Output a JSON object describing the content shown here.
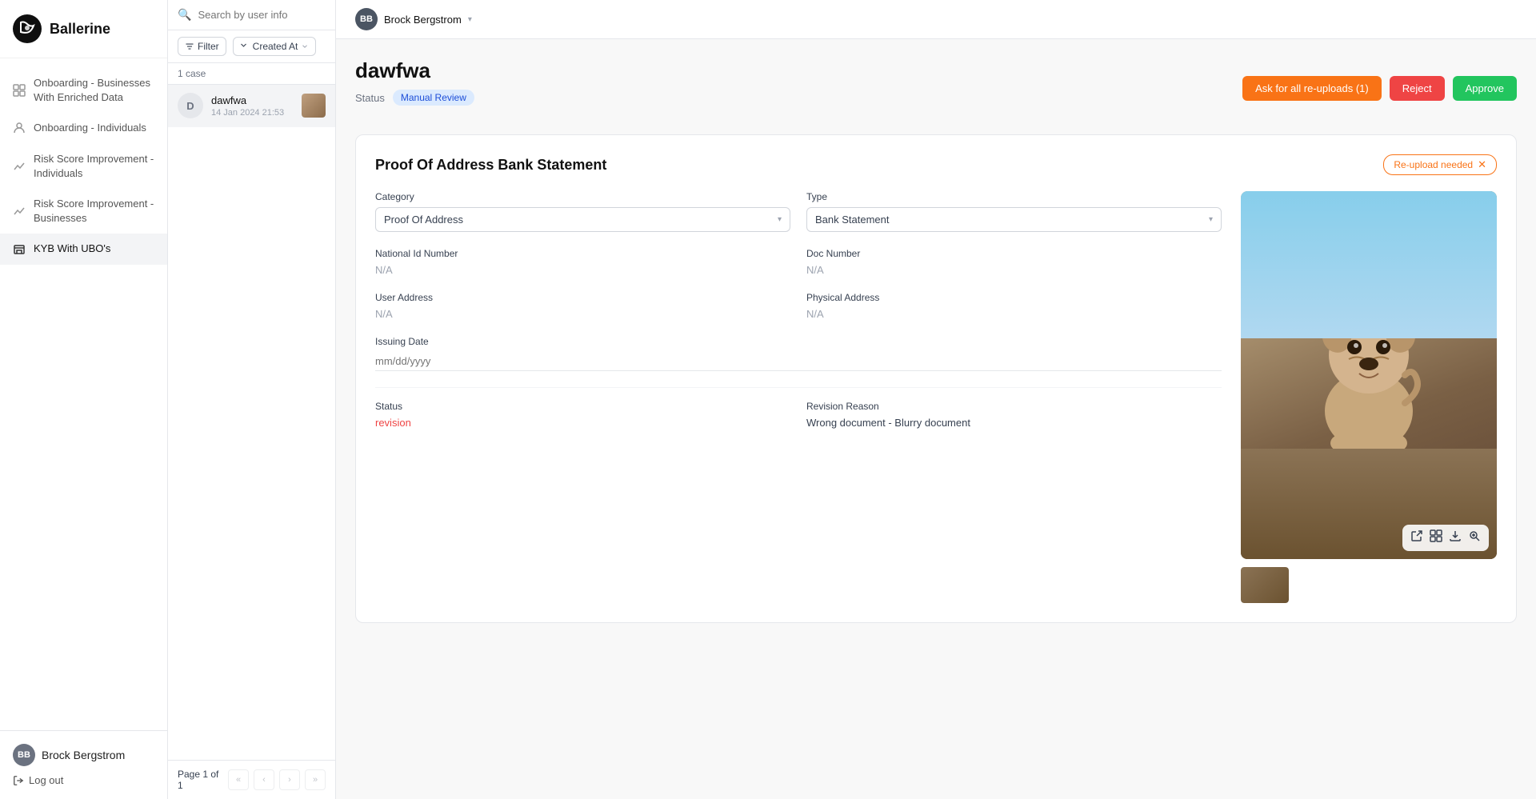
{
  "app": {
    "name": "Ballerine"
  },
  "sidebar": {
    "logo_text": "Ballerine",
    "nav_items": [
      {
        "id": "onboarding-businesses",
        "label": "Onboarding - Businesses With Enriched Data",
        "icon": "grid-icon",
        "active": false
      },
      {
        "id": "onboarding-individuals",
        "label": "Onboarding - Individuals",
        "icon": "person-icon",
        "active": false
      },
      {
        "id": "risk-individuals",
        "label": "Risk Score Improvement - Individuals",
        "icon": "chart-icon",
        "active": false
      },
      {
        "id": "risk-businesses",
        "label": "Risk Score Improvement - Businesses",
        "icon": "chart-icon",
        "active": false
      },
      {
        "id": "kyb-ubo",
        "label": "KYB With UBO's",
        "icon": "building-icon",
        "active": true
      }
    ],
    "footer": {
      "user_name": "Brock Bergstrom",
      "logout_label": "Log out"
    }
  },
  "case_panel": {
    "search_placeholder": "Search by user info",
    "filter_label": "Filter",
    "sort_label": "Created At",
    "case_count": "1 case",
    "cases": [
      {
        "id": "dawfwa",
        "name": "dawfwa",
        "date": "14 Jan 2024 21:53",
        "avatar_letter": "D",
        "selected": true
      }
    ],
    "pagination": {
      "page_info": "Page 1 of 1",
      "first_label": "«",
      "prev_label": "‹",
      "next_label": "›",
      "last_label": "»"
    }
  },
  "topbar": {
    "user_name": "Brock Bergstrom"
  },
  "main": {
    "case_title": "dawfwa",
    "status_label": "Status",
    "status_value": "Manual Review",
    "action_buttons": {
      "ask_reupload": "Ask for all re-uploads (1)",
      "reject": "Reject",
      "approve": "Approve"
    },
    "document": {
      "title": "Proof Of Address Bank Statement",
      "reupload_badge": "Re-upload needed",
      "category_label": "Category",
      "category_value": "Proof Of Address",
      "type_label": "Type",
      "type_value": "Bank Statement",
      "national_id_label": "National Id Number",
      "national_id_value": "N/A",
      "doc_number_label": "Doc Number",
      "doc_number_value": "N/A",
      "user_address_label": "User Address",
      "user_address_value": "N/A",
      "physical_address_label": "Physical Address",
      "physical_address_value": "N/A",
      "issuing_date_label": "Issuing Date",
      "issuing_date_placeholder": "mm/dd/yyyy",
      "status_label": "Status",
      "status_value": "revision",
      "revision_reason_label": "Revision Reason",
      "revision_reason_value": "Wrong document - Blurry document"
    }
  }
}
